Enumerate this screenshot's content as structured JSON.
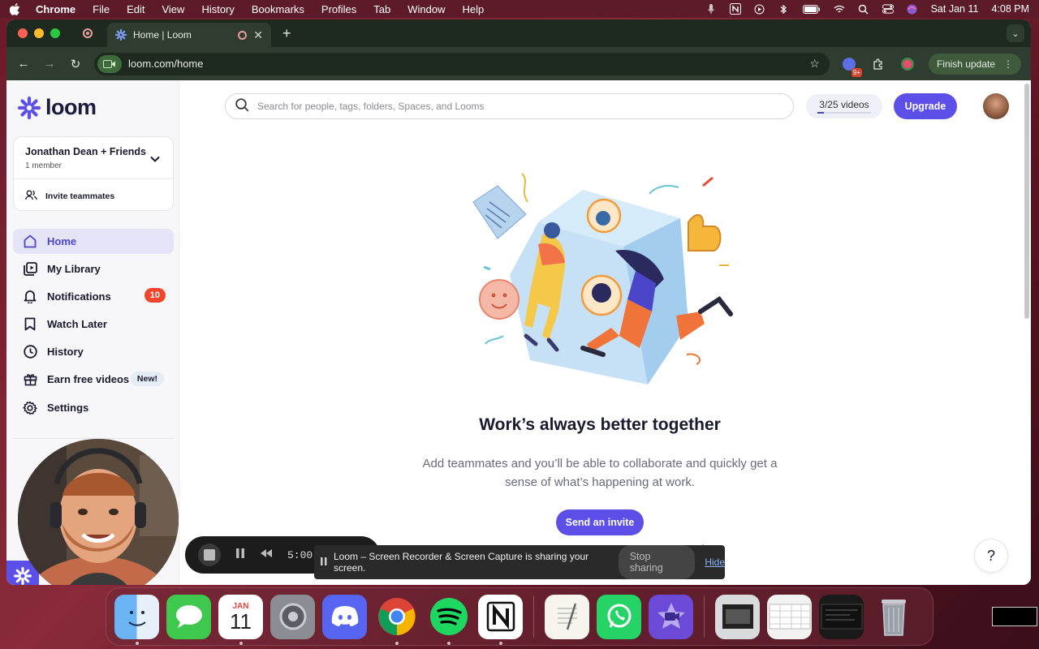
{
  "menubar": {
    "app": "Chrome",
    "items": [
      "File",
      "Edit",
      "View",
      "History",
      "Bookmarks",
      "Profiles",
      "Tab",
      "Window",
      "Help"
    ],
    "date": "Sat Jan 11",
    "time": "4:08 PM"
  },
  "browser": {
    "tab_title": "Home | Loom",
    "url": "loom.com/home",
    "ext_badge": "9+",
    "finish_update": "Finish update"
  },
  "sidebar": {
    "logo": "loom",
    "workspace": {
      "name": "Jonathan Dean + Friends",
      "members": "1 member",
      "invite": "Invite teammates"
    },
    "nav": [
      {
        "label": "Home",
        "icon": "home-icon"
      },
      {
        "label": "My Library",
        "icon": "library-icon"
      },
      {
        "label": "Notifications",
        "icon": "bell-icon",
        "badge": "10"
      },
      {
        "label": "Watch Later",
        "icon": "bookmark-icon"
      },
      {
        "label": "History",
        "icon": "clock-icon"
      },
      {
        "label": "Earn free videos",
        "icon": "gift-icon",
        "badge": "New!"
      },
      {
        "label": "Settings",
        "icon": "gear-icon"
      }
    ]
  },
  "header": {
    "search_placeholder": "Search for people, tags, folders, Spaces, and Looms",
    "quota": "3/25 videos",
    "quota_fraction": 0.12,
    "upgrade": "Upgrade"
  },
  "hero": {
    "title": "Work’s always better together",
    "subtitle": "Add teammates and you’ll be able to collaborate and quickly get a sense of what’s happening at work.",
    "cta": "Send an invite"
  },
  "help": "?",
  "recorder": {
    "time": "5:00"
  },
  "share_bar": {
    "message": "Loom – Screen Recorder & Screen Capture is sharing your screen.",
    "stop": "Stop sharing",
    "hide": "Hide"
  },
  "dock": {
    "calendar_month": "JAN",
    "calendar_day": "11"
  },
  "colors": {
    "accent": "#5b4fe8",
    "badge": "#f0452b",
    "chrome": "#2f3d30"
  }
}
